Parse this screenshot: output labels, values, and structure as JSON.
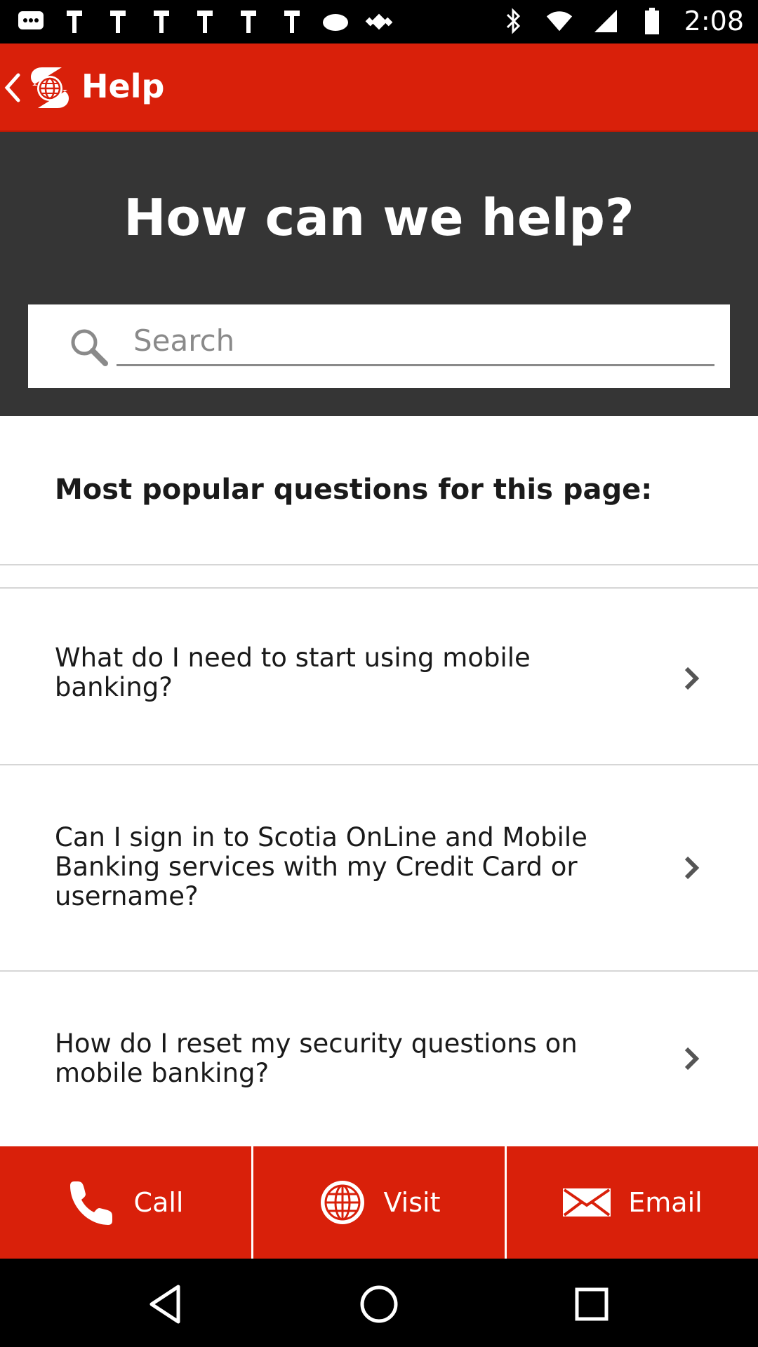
{
  "status_bar": {
    "time": "2:08",
    "icons": [
      "message-icon",
      "notification-icon",
      "notification-icon",
      "notification-icon",
      "notification-icon",
      "notification-icon",
      "notification-icon",
      "fake-gps-icon",
      "bluetooth-icon",
      "wifi-icon",
      "signal-icon",
      "battery-icon"
    ]
  },
  "app_bar": {
    "title": "Help",
    "brand_color": "#d9200a"
  },
  "hero": {
    "title": "How can we help?",
    "search_placeholder": "Search",
    "background": "#353535"
  },
  "faq": {
    "section_title": "Most popular questions for this page:",
    "items": [
      {
        "question": "What do I need to start using mobile banking?"
      },
      {
        "question": "Can I sign in to Scotia OnLine and Mobile Banking services with my Credit Card or username?"
      },
      {
        "question": "How do I reset my security questions on mobile banking?"
      }
    ]
  },
  "actions": {
    "call_label": "Call",
    "visit_label": "Visit",
    "email_label": "Email"
  }
}
